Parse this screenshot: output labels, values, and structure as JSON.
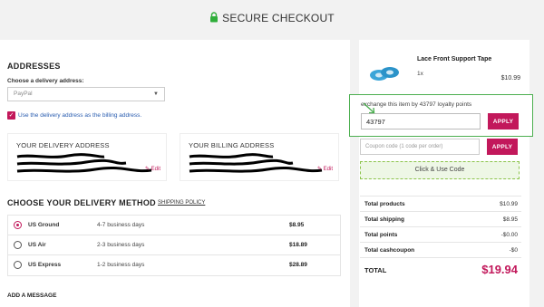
{
  "header": {
    "title": "SECURE CHECKOUT",
    "icon": "lock-icon",
    "accent_color": "#2fae3a"
  },
  "addresses": {
    "title": "ADDRESSES",
    "choose_label": "Choose a delivery address:",
    "selected_address": "PayPal",
    "use_as_billing_label": "Use the delivery address as the billing address.",
    "use_as_billing_checked": true,
    "delivery_card": {
      "title": "YOUR DELIVERY ADDRESS",
      "edit_label": "Edit"
    },
    "billing_card": {
      "title": "YOUR BILLING ADDRESS",
      "edit_label": "Edit"
    }
  },
  "delivery_method": {
    "title": "CHOOSE YOUR DELIVERY METHOD",
    "policy_link": "SHIPPING POLICY",
    "options": [
      {
        "name": "US Ground",
        "days": "4-7 business days",
        "price": "$8.95",
        "selected": true
      },
      {
        "name": "US Air",
        "days": "2-3 business days",
        "price": "$18.89",
        "selected": false
      },
      {
        "name": "US Express",
        "days": "1-2 business days",
        "price": "$28.89",
        "selected": false
      }
    ]
  },
  "add_message_label": "ADD A MESSAGE",
  "cart": {
    "product": {
      "name": "Lace Front Support Tape",
      "qty": "1x",
      "price": "$10.99"
    },
    "loyalty": {
      "text": "exchange this item by 43797 loyalty points",
      "value": "43797",
      "apply_label": "APPLY"
    },
    "coupon": {
      "placeholder": "Coupon code (1 code per order)",
      "apply_label": "APPLY"
    },
    "click_use_label": "Click & Use Code",
    "totals": [
      {
        "label": "Total products",
        "value": "$10.99"
      },
      {
        "label": "Total shipping",
        "value": "$8.95"
      },
      {
        "label": "Total points",
        "value": "-$0.00"
      },
      {
        "label": "Total cashcoupon",
        "value": "-$0"
      }
    ],
    "grand_total": {
      "label": "TOTAL",
      "value": "$19.94"
    }
  },
  "colors": {
    "brand": "#c2185b",
    "highlight": "#4caf50"
  }
}
